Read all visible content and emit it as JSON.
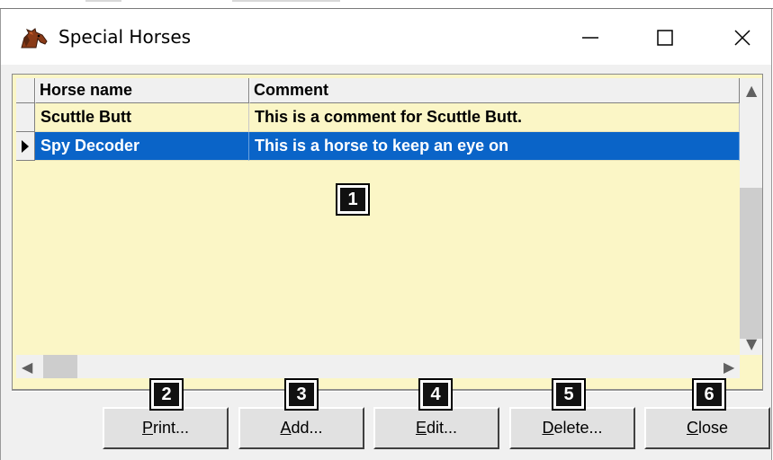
{
  "window": {
    "title": "Special Horses",
    "minimize_glyph": "—",
    "maximize_glyph": "☐",
    "close_glyph": "✕"
  },
  "grid": {
    "columns": [
      "Horse name",
      "Comment"
    ],
    "rows": [
      {
        "name": "Scuttle Butt",
        "comment": "This is a comment for Scuttle Butt.",
        "selected": false
      },
      {
        "name": "Spy Decoder",
        "comment": "This is a horse to keep an eye on",
        "selected": true
      }
    ],
    "colors": {
      "background": "#fbf6c6",
      "selected_row": "#0a64c8"
    }
  },
  "buttons": {
    "print": {
      "accel": "P",
      "rest": "rint..."
    },
    "add": {
      "accel": "A",
      "rest": "dd..."
    },
    "edit": {
      "accel": "E",
      "rest": "dit..."
    },
    "delete": {
      "accel": "D",
      "rest": "elete..."
    },
    "close": {
      "accel": "C",
      "rest": "lose"
    }
  },
  "badges": [
    "1",
    "2",
    "3",
    "4",
    "5",
    "6"
  ],
  "icons": {
    "app": "horse-head-icon",
    "row_pointer": "triangle-right-icon"
  }
}
